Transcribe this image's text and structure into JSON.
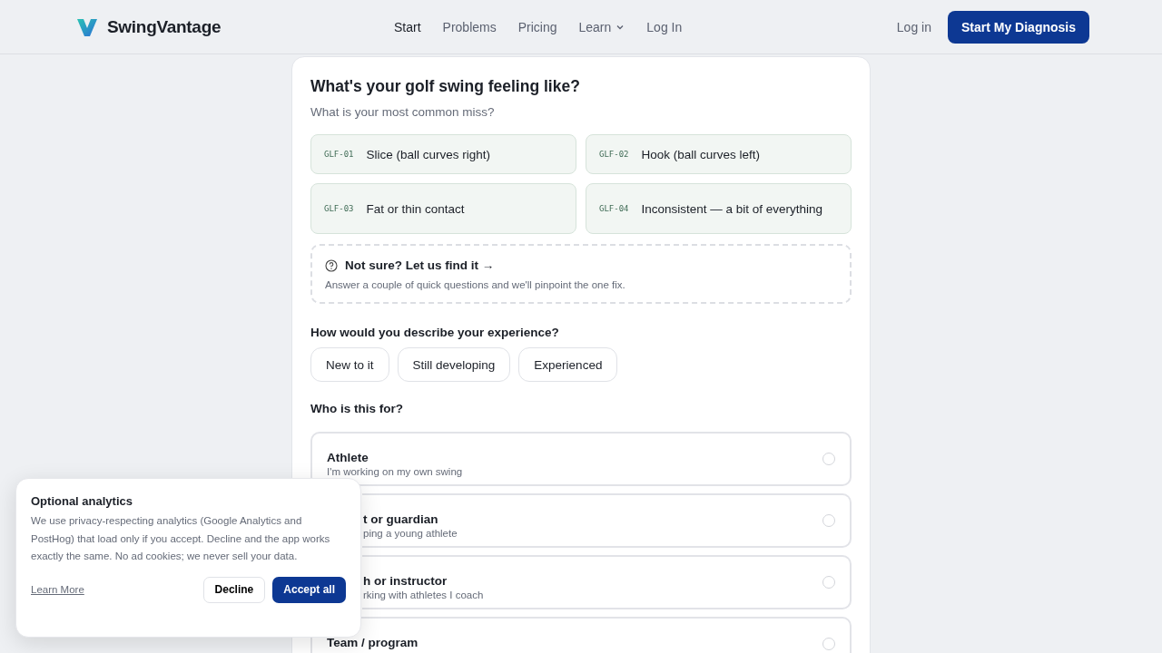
{
  "brand": {
    "name": "SwingVantage"
  },
  "nav": [
    {
      "label": "Start",
      "selected": true,
      "kind": "link"
    },
    {
      "label": "Problems",
      "selected": false,
      "kind": "link"
    },
    {
      "label": "Pricing",
      "selected": false,
      "kind": "link"
    },
    {
      "label": "Learn",
      "selected": false,
      "kind": "menu"
    },
    {
      "label": "Log In",
      "selected": false,
      "kind": "link"
    }
  ],
  "header_actions": {
    "login": "Log in",
    "cta": "Start My Diagnosis"
  },
  "quiz": {
    "title": "What's your golf swing feeling like?",
    "subtitle": "What is your most common miss?",
    "misses": [
      {
        "code": "GLF-01",
        "label": "Slice (ball curves right)"
      },
      {
        "code": "GLF-02",
        "label": "Hook (ball curves left)"
      },
      {
        "code": "GLF-03",
        "label": "Fat or thin contact"
      },
      {
        "code": "GLF-04",
        "label": "Inconsistent — a bit of everything"
      }
    ],
    "not_sure": {
      "title": "Not sure? Let us find it →",
      "text": "Answer a couple of quick questions and we'll pinpoint the one fix."
    },
    "experience_label": "How would you describe your experience?",
    "experience": [
      {
        "label": "New to it",
        "selected": false
      },
      {
        "label": "Still developing",
        "selected": false
      },
      {
        "label": "Experienced",
        "selected": false
      }
    ],
    "audience_label": "Who is this for?",
    "audience": [
      {
        "title": "Athlete",
        "text": "I'm working on my own swing",
        "selected": false,
        "kind": "full"
      },
      {
        "title": "t or guardian",
        "text": "ping a young athlete",
        "selected": false,
        "kind": "covered"
      },
      {
        "title": "h or instructor",
        "text": "rking with athletes I coach",
        "selected": false,
        "kind": "covered"
      },
      {
        "title": "Team / program",
        "selected": false,
        "kind": "full"
      }
    ]
  },
  "cookie": {
    "title": "Optional analytics",
    "text": "We use privacy-respecting analytics (Google Analytics and PostHog) that load only if you accept. Decline and the app works exactly the same. No ad cookies; we never sell your data.",
    "link": "Learn More",
    "decline": "Decline",
    "accept": "Accept all"
  }
}
